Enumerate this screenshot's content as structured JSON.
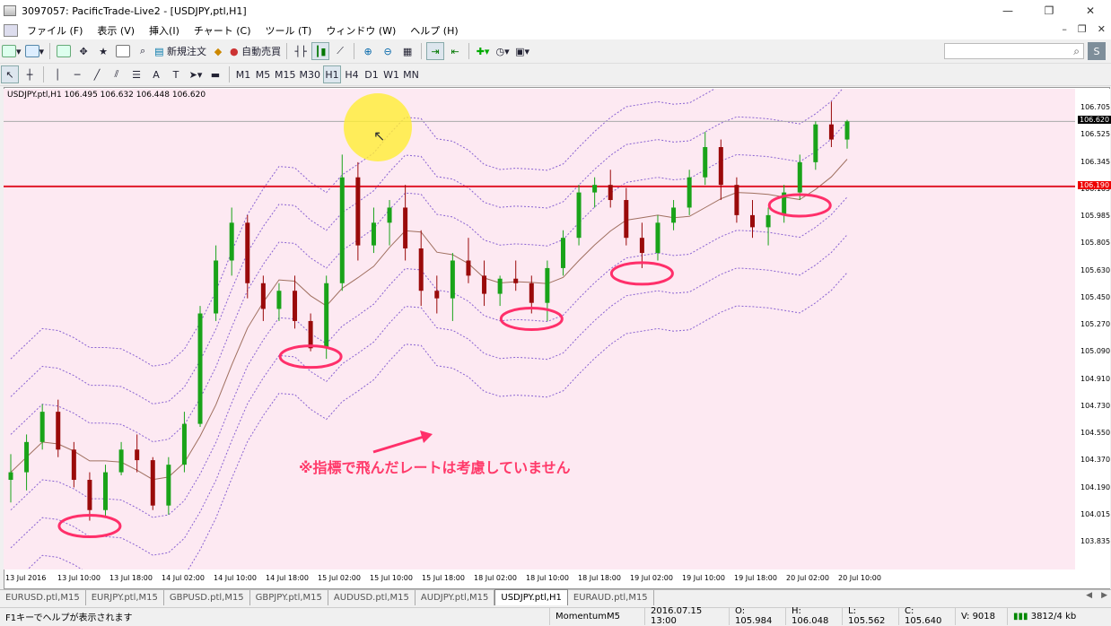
{
  "window": {
    "title": "3097057: PacificTrade-Live2 - [USDJPY,ptl,H1]",
    "min": "—",
    "max": "❐",
    "close": "✕"
  },
  "menu": [
    "ファイル (F)",
    "表示 (V)",
    "挿入(I)",
    "チャート (C)",
    "ツール (T)",
    "ウィンドウ (W)",
    "ヘルプ (H)"
  ],
  "toolbar": {
    "new_order": "新規注文",
    "auto_trade": "自動売買"
  },
  "timeframes": [
    "M1",
    "M5",
    "M15",
    "M30",
    "H1",
    "H4",
    "D1",
    "W1",
    "MN"
  ],
  "active_timeframe": "H1",
  "chart": {
    "symbol_info": "USDJPY.ptl,H1  106.495 106.632 106.448 106.620",
    "yticks": [
      "106.705",
      "106.525",
      "106.345",
      "106.165",
      "105.985",
      "105.805",
      "105.630",
      "105.450",
      "105.270",
      "105.090",
      "104.910",
      "104.730",
      "104.550",
      "104.370",
      "104.190",
      "104.015",
      "103.835"
    ],
    "current_price": "106.620",
    "line_price": "106.190",
    "xticks": [
      "13 Jul 2016",
      "13 Jul 10:00",
      "13 Jul 18:00",
      "14 Jul 02:00",
      "14 Jul 10:00",
      "14 Jul 18:00",
      "15 Jul 02:00",
      "15 Jul 10:00",
      "15 Jul 18:00",
      "18 Jul 02:00",
      "18 Jul 10:00",
      "18 Jul 18:00",
      "19 Jul 02:00",
      "19 Jul 10:00",
      "19 Jul 18:00",
      "20 Jul 02:00",
      "20 Jul 10:00"
    ],
    "annotation": "※指標で飛んだレートは考慮していません",
    "colors": {
      "background": "#fde9f2",
      "bull": "#19a319",
      "bear": "#9a0a0a",
      "band": "#8a63d2",
      "level": "#e0182a",
      "circle": "#ff2f6a",
      "ma": "#a07060"
    }
  },
  "chart_data": {
    "type": "candlestick",
    "interval": "H1",
    "ylim": [
      103.835,
      106.705
    ],
    "candles": [
      [
        104.25,
        104.42,
        104.1,
        104.3
      ],
      [
        104.3,
        104.55,
        104.18,
        104.5
      ],
      [
        104.5,
        104.75,
        104.45,
        104.7
      ],
      [
        104.7,
        104.78,
        104.4,
        104.45
      ],
      [
        104.45,
        104.5,
        104.2,
        104.25
      ],
      [
        104.25,
        104.3,
        103.98,
        104.05
      ],
      [
        104.05,
        104.35,
        104.0,
        104.3
      ],
      [
        104.3,
        104.5,
        104.28,
        104.45
      ],
      [
        104.45,
        104.55,
        104.3,
        104.38
      ],
      [
        104.38,
        104.4,
        104.05,
        104.08
      ],
      [
        104.08,
        104.4,
        104.02,
        104.35
      ],
      [
        104.35,
        104.7,
        104.3,
        104.62
      ],
      [
        104.62,
        105.4,
        104.6,
        105.35
      ],
      [
        105.35,
        105.8,
        105.3,
        105.7
      ],
      [
        105.7,
        106.05,
        105.6,
        105.95
      ],
      [
        105.95,
        106.0,
        105.45,
        105.55
      ],
      [
        105.55,
        105.6,
        105.3,
        105.38
      ],
      [
        105.38,
        105.55,
        105.3,
        105.5
      ],
      [
        105.5,
        105.6,
        105.25,
        105.3
      ],
      [
        105.3,
        105.35,
        105.1,
        105.12
      ],
      [
        105.12,
        105.6,
        105.05,
        105.55
      ],
      [
        105.55,
        106.4,
        105.5,
        106.25
      ],
      [
        106.25,
        106.35,
        105.7,
        105.8
      ],
      [
        105.8,
        106.05,
        105.75,
        105.95
      ],
      [
        105.95,
        106.1,
        105.8,
        106.05
      ],
      [
        106.05,
        106.2,
        105.7,
        105.78
      ],
      [
        105.78,
        105.9,
        105.4,
        105.5
      ],
      [
        105.5,
        105.6,
        105.35,
        105.45
      ],
      [
        105.45,
        105.75,
        105.3,
        105.7
      ],
      [
        105.7,
        105.85,
        105.55,
        105.6
      ],
      [
        105.6,
        105.7,
        105.4,
        105.48
      ],
      [
        105.48,
        105.6,
        105.4,
        105.58
      ],
      [
        105.58,
        105.7,
        105.5,
        105.55
      ],
      [
        105.55,
        105.6,
        105.35,
        105.42
      ],
      [
        105.42,
        105.7,
        105.3,
        105.65
      ],
      [
        105.65,
        105.9,
        105.6,
        105.85
      ],
      [
        105.85,
        106.2,
        105.8,
        106.15
      ],
      [
        106.15,
        106.25,
        106.05,
        106.2
      ],
      [
        106.2,
        106.3,
        106.05,
        106.1
      ],
      [
        106.1,
        106.18,
        105.8,
        105.85
      ],
      [
        105.85,
        105.95,
        105.65,
        105.75
      ],
      [
        105.75,
        106.0,
        105.7,
        105.95
      ],
      [
        105.95,
        106.1,
        105.9,
        106.05
      ],
      [
        106.05,
        106.3,
        106.0,
        106.25
      ],
      [
        106.25,
        106.55,
        106.2,
        106.45
      ],
      [
        106.45,
        106.5,
        106.1,
        106.2
      ],
      [
        106.2,
        106.25,
        105.95,
        106.0
      ],
      [
        106.0,
        106.1,
        105.85,
        105.92
      ],
      [
        105.92,
        106.05,
        105.8,
        106.0
      ],
      [
        106.0,
        106.2,
        105.95,
        106.15
      ],
      [
        106.15,
        106.4,
        106.1,
        106.35
      ],
      [
        106.35,
        106.62,
        106.3,
        106.6
      ],
      [
        106.6,
        106.75,
        106.45,
        106.5
      ],
      [
        106.5,
        106.63,
        106.44,
        106.62
      ]
    ]
  },
  "tabs": [
    "EURUSD.ptl,M15",
    "EURJPY.ptl,M15",
    "GBPUSD.ptl,M15",
    "GBPJPY.ptl,M15",
    "AUDUSD.ptl,M15",
    "AUDJPY.ptl,M15",
    "USDJPY.ptl,H1",
    "EURAUD.ptl,M15"
  ],
  "active_tab": "USDJPY.ptl,H1",
  "status": {
    "help": "F1キーでヘルプが表示されます",
    "profile": "MomentumM5",
    "time": "2016.07.15 13:00",
    "open": "O: 105.984",
    "high": "H: 106.048",
    "low": "L: 105.562",
    "close": "C: 105.640",
    "volume": "V: 9018",
    "traffic": "3812/4 kb"
  }
}
